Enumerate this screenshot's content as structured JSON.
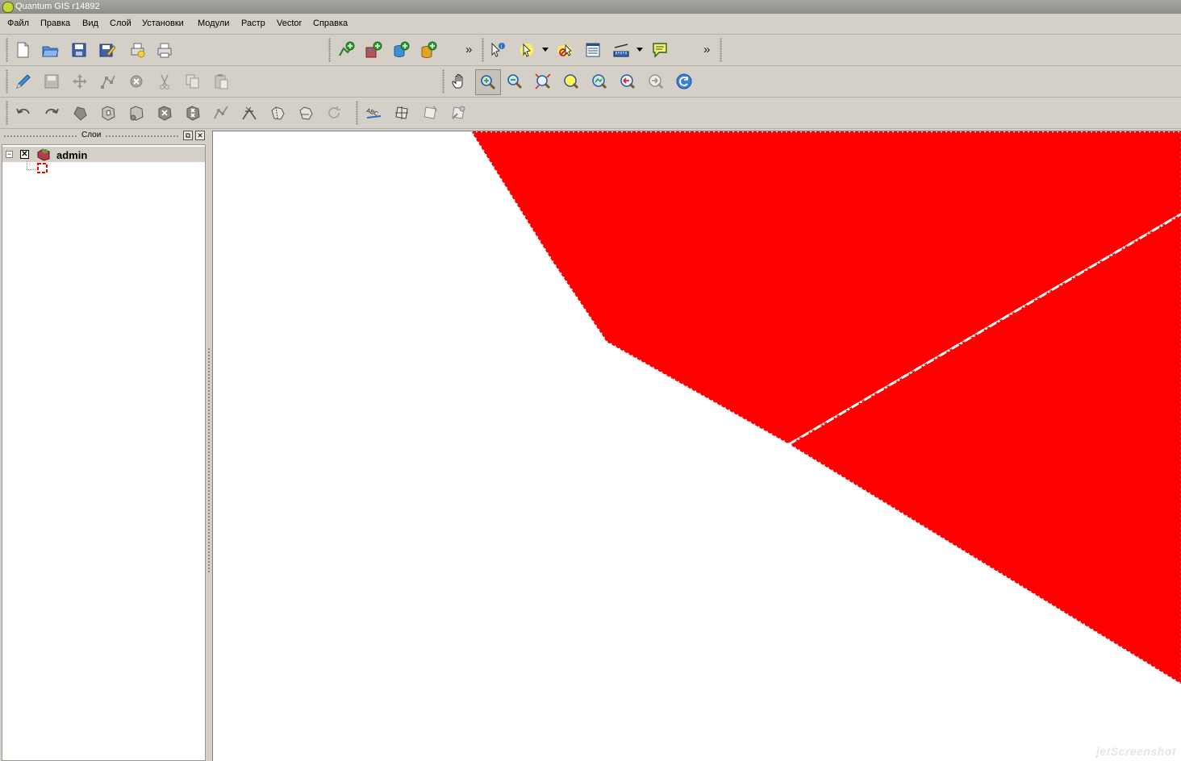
{
  "window": {
    "title": "Quantum GIS r14892"
  },
  "menu": [
    "Файл",
    "Правка",
    "Вид",
    "Слой",
    "Установки",
    "Модули",
    "Растр",
    "Vector",
    "Справка"
  ],
  "toolbar": {
    "overflow_label": "»"
  },
  "layers_panel": {
    "title": "Слои",
    "float_button": "⧉",
    "close_button": "✕",
    "layers": [
      {
        "name": "admin",
        "visible": true,
        "check_glyph": "✕",
        "expander": "−",
        "symbol_color": "#ff0000"
      }
    ]
  },
  "map": {
    "background": "#ffffff",
    "polygon_fill": "#ff0000",
    "outline_style": "white dotted"
  },
  "watermark": "jetScreenshot",
  "colors": {
    "window_bg": "#d4d0c8",
    "title_bar": "#8f8d88"
  }
}
